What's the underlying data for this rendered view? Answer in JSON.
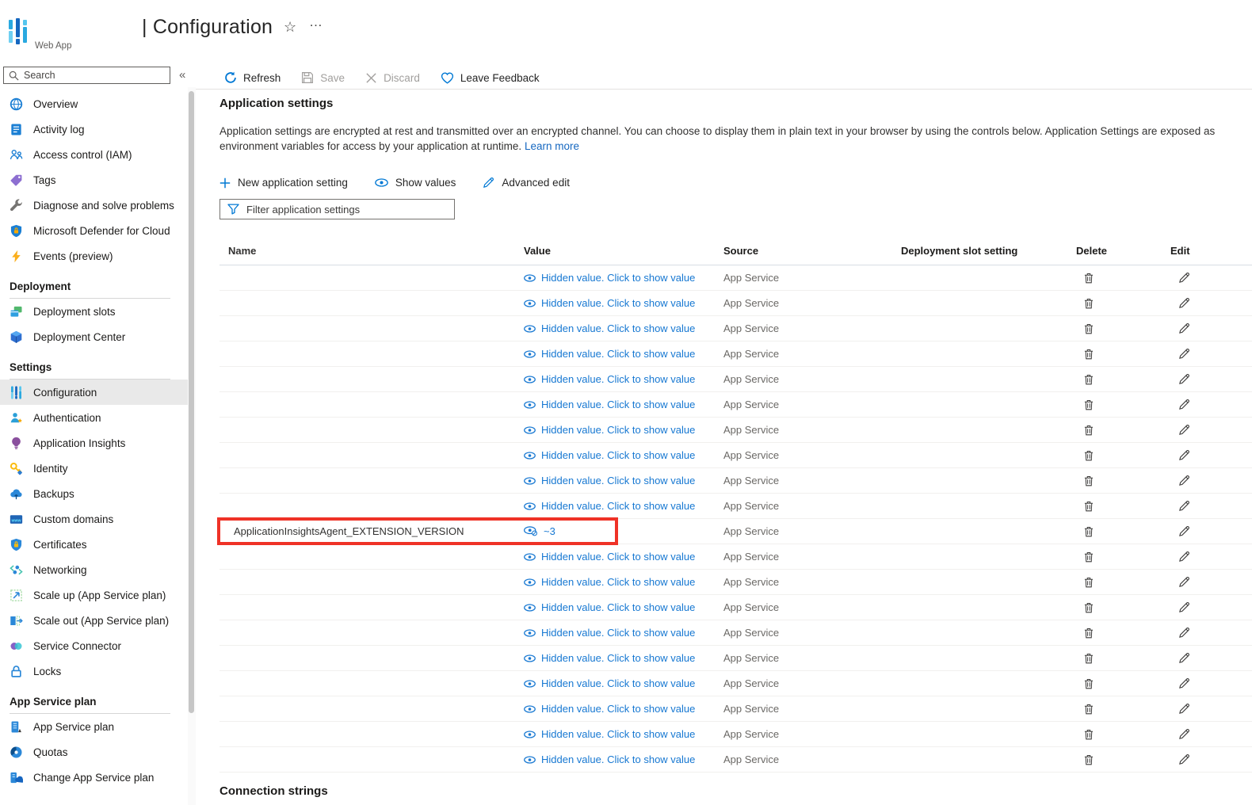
{
  "header": {
    "app_label": "Web App",
    "page_title": "| Configuration",
    "favorite_icon": "☆",
    "more_icon": "…"
  },
  "sidebar": {
    "search_placeholder": "Search",
    "collapse_label": "«",
    "sections": [
      {
        "title": "",
        "items": [
          {
            "label": "Overview",
            "icon": "overview-icon"
          },
          {
            "label": "Activity log",
            "icon": "activity-log-icon"
          },
          {
            "label": "Access control (IAM)",
            "icon": "access-control-icon"
          },
          {
            "label": "Tags",
            "icon": "tags-icon"
          },
          {
            "label": "Diagnose and solve problems",
            "icon": "diagnose-icon"
          },
          {
            "label": "Microsoft Defender for Cloud",
            "icon": "defender-icon"
          },
          {
            "label": "Events (preview)",
            "icon": "events-icon"
          }
        ]
      },
      {
        "title": "Deployment",
        "items": [
          {
            "label": "Deployment slots",
            "icon": "deployment-slots-icon"
          },
          {
            "label": "Deployment Center",
            "icon": "deployment-center-icon"
          }
        ]
      },
      {
        "title": "Settings",
        "items": [
          {
            "label": "Configuration",
            "icon": "configuration-icon",
            "selected": true
          },
          {
            "label": "Authentication",
            "icon": "authentication-icon"
          },
          {
            "label": "Application Insights",
            "icon": "app-insights-icon"
          },
          {
            "label": "Identity",
            "icon": "identity-icon"
          },
          {
            "label": "Backups",
            "icon": "backups-icon"
          },
          {
            "label": "Custom domains",
            "icon": "custom-domains-icon"
          },
          {
            "label": "Certificates",
            "icon": "certificates-icon"
          },
          {
            "label": "Networking",
            "icon": "networking-icon"
          },
          {
            "label": "Scale up (App Service plan)",
            "icon": "scale-up-icon"
          },
          {
            "label": "Scale out (App Service plan)",
            "icon": "scale-out-icon"
          },
          {
            "label": "Service Connector",
            "icon": "service-connector-icon"
          },
          {
            "label": "Locks",
            "icon": "locks-icon"
          }
        ]
      },
      {
        "title": "App Service plan",
        "items": [
          {
            "label": "App Service plan",
            "icon": "asp-icon"
          },
          {
            "label": "Quotas",
            "icon": "quotas-icon"
          },
          {
            "label": "Change App Service plan",
            "icon": "change-asp-icon"
          }
        ]
      }
    ]
  },
  "toolbar": {
    "buttons": [
      {
        "label": "Refresh",
        "icon": "refresh-icon",
        "enabled": true
      },
      {
        "label": "Save",
        "icon": "save-icon",
        "enabled": false
      },
      {
        "label": "Discard",
        "icon": "discard-icon",
        "enabled": false
      },
      {
        "label": "Leave Feedback",
        "icon": "heart-icon",
        "enabled": true
      }
    ]
  },
  "main": {
    "section_title": "Application settings",
    "description_line1": "Application settings are encrypted at rest and transmitted over an encrypted channel. You can choose to display them in plain text in your browser by using the controls below. Application Settings are exposed as",
    "description_line2": "environment variables for access by your application at runtime.",
    "learn_more_label": "Learn more",
    "actions": [
      {
        "label": "New application setting",
        "icon": "plus-icon"
      },
      {
        "label": "Show values",
        "icon": "eye-icon"
      },
      {
        "label": "Advanced edit",
        "icon": "pencil-blue-icon"
      }
    ],
    "filter_placeholder": "Filter application settings",
    "table": {
      "headers": [
        "Name",
        "Value",
        "Source",
        "Deployment slot setting",
        "Delete",
        "Edit"
      ],
      "hidden_value_label": "Hidden value. Click to show value",
      "rows": [
        {
          "name": "",
          "value_state": "hidden",
          "source": "App Service"
        },
        {
          "name": "",
          "value_state": "hidden",
          "source": "App Service"
        },
        {
          "name": "",
          "value_state": "hidden",
          "source": "App Service"
        },
        {
          "name": "",
          "value_state": "hidden",
          "source": "App Service"
        },
        {
          "name": "",
          "value_state": "hidden",
          "source": "App Service"
        },
        {
          "name": "",
          "value_state": "hidden",
          "source": "App Service"
        },
        {
          "name": "",
          "value_state": "hidden",
          "source": "App Service"
        },
        {
          "name": "",
          "value_state": "hidden",
          "source": "App Service"
        },
        {
          "name": "",
          "value_state": "hidden",
          "source": "App Service"
        },
        {
          "name": "",
          "value_state": "hidden",
          "source": "App Service"
        },
        {
          "name": "ApplicationInsightsAgent_EXTENSION_VERSION",
          "value_state": "shown",
          "value": "~3",
          "source": "App Service",
          "highlighted": true
        },
        {
          "name": "",
          "value_state": "hidden",
          "source": "App Service"
        },
        {
          "name": "",
          "value_state": "hidden",
          "source": "App Service"
        },
        {
          "name": "",
          "value_state": "hidden",
          "source": "App Service"
        },
        {
          "name": "",
          "value_state": "hidden",
          "source": "App Service"
        },
        {
          "name": "",
          "value_state": "hidden",
          "source": "App Service"
        },
        {
          "name": "",
          "value_state": "hidden",
          "source": "App Service"
        },
        {
          "name": "",
          "value_state": "hidden",
          "source": "App Service"
        },
        {
          "name": "",
          "value_state": "hidden",
          "source": "App Service"
        },
        {
          "name": "",
          "value_state": "hidden",
          "source": "App Service"
        }
      ]
    },
    "connection_strings_title": "Connection strings"
  },
  "colors": {
    "accent": "#0078d4",
    "link": "#1778d2",
    "highlight_border": "#ef3227",
    "source_text": "#6b6966",
    "disabled_text": "#a19f9d"
  }
}
